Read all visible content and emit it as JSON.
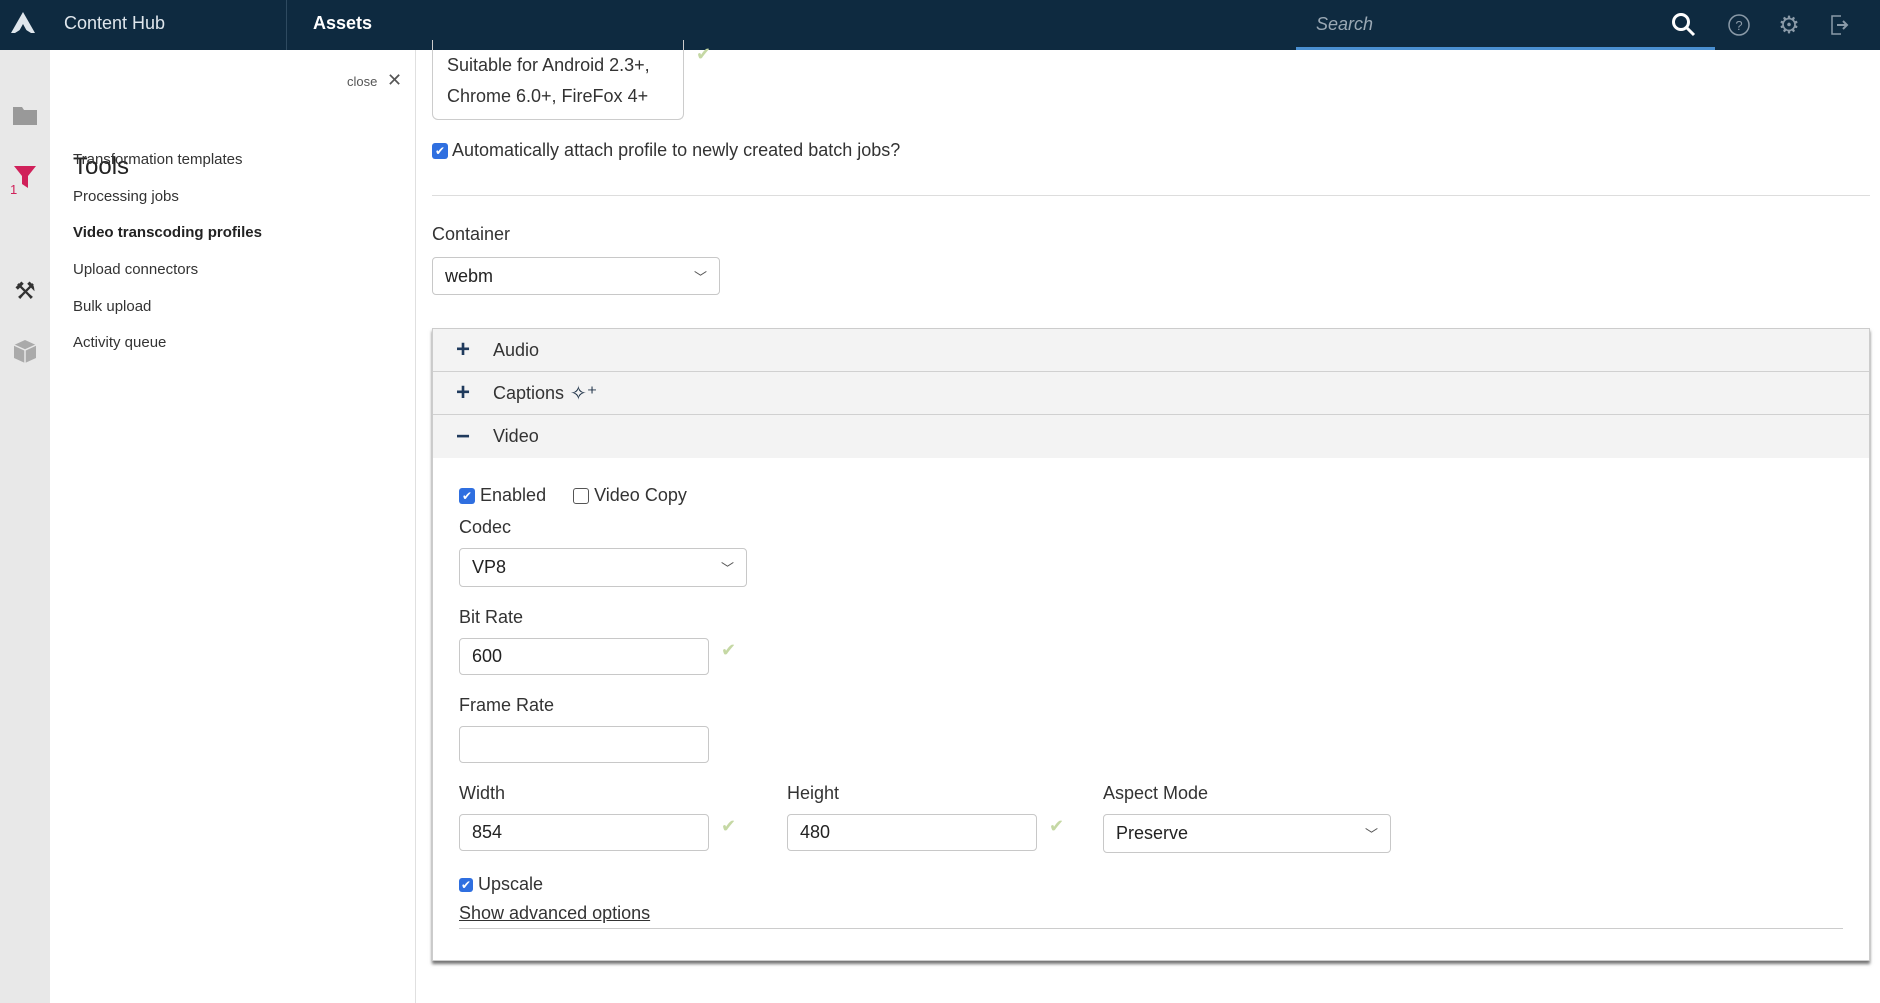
{
  "header": {
    "brand": "Content Hub",
    "section": "Assets",
    "search_placeholder": "Search",
    "icons": [
      "logo-icon",
      "search-icon",
      "help-icon",
      "gear-icon",
      "logout-icon"
    ]
  },
  "rail": {
    "icons": [
      "folder-icon",
      "filter-icon",
      "tools-icon",
      "box-icon"
    ],
    "filter_count": "1",
    "accent": "#d0215a"
  },
  "panel": {
    "close_label": "close",
    "title": "Tools",
    "items": [
      {
        "label": "Transformation templates",
        "active": false
      },
      {
        "label": "Processing jobs",
        "active": false
      },
      {
        "label": "Video transcoding profiles",
        "active": true
      },
      {
        "label": "Upload connectors",
        "active": false
      },
      {
        "label": "Bulk upload",
        "active": false
      },
      {
        "label": "Activity queue",
        "active": false
      }
    ]
  },
  "form": {
    "description": "Suitable for Android 2.3+, Chrome 6.0+, FireFox 4+",
    "auto_attach_label": "Automatically attach profile to newly created batch jobs?",
    "auto_attach": true,
    "container_label": "Container",
    "container_value": "webm",
    "sections": [
      {
        "label": "Audio",
        "expanded": false
      },
      {
        "label": "Captions",
        "expanded": false
      },
      {
        "label": "Video",
        "expanded": true
      }
    ],
    "video": {
      "enabled_label": "Enabled",
      "enabled": true,
      "copy_label": "Video Copy",
      "copy": false,
      "codec_label": "Codec",
      "codec_value": "VP8",
      "bitrate_label": "Bit Rate",
      "bitrate_value": "600",
      "framerate_label": "Frame Rate",
      "framerate_value": "",
      "width_label": "Width",
      "width_value": "854",
      "height_label": "Height",
      "height_value": "480",
      "aspect_label": "Aspect Mode",
      "aspect_value": "Preserve",
      "upscale_label": "Upscale",
      "upscale": true,
      "advanced_link": "Show advanced options"
    }
  }
}
